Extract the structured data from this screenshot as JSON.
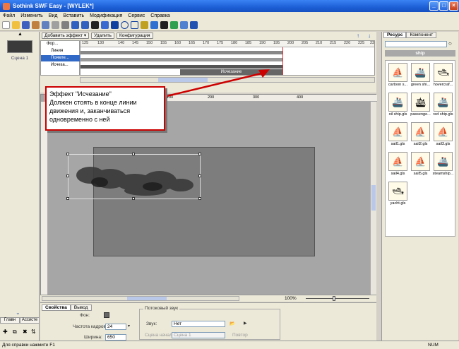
{
  "window": {
    "title": "Sothink SWF Easy - [WYLEK*]"
  },
  "menu": [
    "Файл",
    "Изменить",
    "Вид",
    "Вставить",
    "Модификация",
    "Сервис",
    "Справка"
  ],
  "left_panel": {
    "scene_label": "Сцена 1",
    "tabs": [
      "Главн",
      "Ассисте"
    ]
  },
  "timeline": {
    "buttons": [
      "Добавить эффект ▾",
      "Удалить",
      "Конфигурация"
    ],
    "frame_numbers": [
      "125",
      "130",
      "140",
      "145",
      "150",
      "155",
      "160",
      "165",
      "170",
      "175",
      "180",
      "185",
      "190",
      "195",
      "200",
      "205",
      "210",
      "215",
      "220",
      "225",
      "230"
    ],
    "layers": [
      {
        "label": "Фор..."
      },
      {
        "label": "Линия"
      },
      {
        "label": "Появле...",
        "selected": true
      },
      {
        "label": "Исчеза..."
      }
    ],
    "effect_label": "Исчезание"
  },
  "callout": {
    "lines": [
      "Эффект \"Исчезание\"",
      "Должен стоять в конце линии",
      "движения и, заканчиваться",
      "одновременно с ней"
    ]
  },
  "canvas": {
    "ruler_marks": [
      "100",
      "200",
      "300",
      "400"
    ],
    "zoom": "100%"
  },
  "right_panel": {
    "tabs": [
      "Ресурс",
      "Компонент"
    ],
    "category": "ship",
    "items": [
      "cartoon s...",
      "green shi...",
      "hovercraf...",
      "oil ship.gls",
      "passenge...",
      "red ship.gls",
      "sail1.gls",
      "sail2.gls",
      "sail3.gls",
      "sail4.gls",
      "sail5.gls",
      "steamship...",
      "yacht.gls"
    ]
  },
  "properties": {
    "tabs": [
      "Свойства",
      "Вывод"
    ],
    "background_label": "Фон:",
    "framerate_label": "Частота кадров:",
    "framerate_value": "24",
    "width_label": "Ширина:",
    "width_value": "650",
    "sound_group": "Потоковый звук",
    "sound_label": "Звук:",
    "sound_value": "Нет",
    "scene_start_label": "Сцена начала:",
    "scene_start_value": "Сцена 1",
    "repeat_label": "Повтор"
  },
  "status": {
    "hint": "Для справки нажмите F1",
    "num": "NUM"
  },
  "colors": {
    "stage": "#7d7d7d",
    "canvas_bg": "#a6a6a6",
    "callout_border": "#cc0000",
    "selected_layer": "#3169c6"
  }
}
